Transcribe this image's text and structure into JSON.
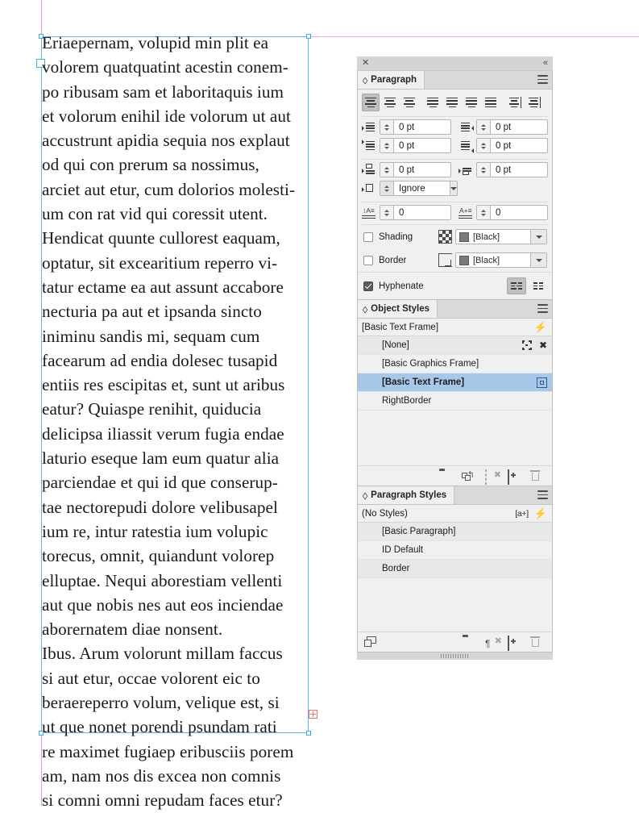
{
  "document": {
    "story_text": "Eriaepernam, volupid min plit ea\nvolorem quatquatint acestin conem-\npo ribusam sam et laboritaquis ium\net volorum enihil ide volorum ut aut\naccustrunt apidia sequia nos explaut\nod qui con prerum sa nossimus,\narciet aut etur, cum dolorios molesti-\num con rat vid qui coressit utent.\nHendicat quunte cullorest eaquam,\noptatur, sit excearitium reperro vi-\ntatur ectame ea aut assunt accabore\nnecturia pa aut et ipsanda sincto\niniminu sandis mi, sequam cum\nfacearum ad endia dolesec tusapid\nentiis res escipitas et, sunt ut aribus\neatur? Quiaspe renihit, quiducia\ndelicipsa iliassit verum fugia endae\nlaturio eseque lam eum quatur alia\nparciendae et qui id que conserup-\ntae nectorepudi dolore velibusapel\nium re, intur ratestia ium volupic\ntorecus, omnit, quiandunt volorep\nelluptae. Nequi aborestiam vellenti\naut que nobis nes aut eos inciendae\naborernatem diae nonsent.\nIbus. Arum volorunt millam faccus\nsi aut etur, occae volorent eic to\nberaereperro volum, velique est, si\nut que nonet porendi psundam rati\nre maximet fugiaep eribusciis porem\nam, nam nos dis excea non comnis\nsi comni omni repudam faces etur?",
    "guide_color": "#f49ef4",
    "frame_color": "#62b7e8"
  },
  "dock": {
    "close_label": "✕",
    "collapse_label": "«"
  },
  "paragraph_panel": {
    "tab_label": "Paragraph",
    "alignment": {
      "selected_index": 0,
      "buttons": [
        "align-left",
        "align-center",
        "align-right",
        "justify-last-left",
        "justify-last-center",
        "justify-last-right",
        "justify-all",
        "align-toward-spine",
        "align-away-from-spine"
      ]
    },
    "fields": [
      {
        "name": "left-indent",
        "value": "0 pt"
      },
      {
        "name": "right-indent",
        "value": "0 pt"
      },
      {
        "name": "first-line-indent",
        "value": "0 pt"
      },
      {
        "name": "last-line-indent",
        "value": "0 pt"
      },
      {
        "name": "space-before",
        "value": "0 pt"
      },
      {
        "name": "space-after",
        "value": "0 pt"
      },
      {
        "name": "drop-cap-lines",
        "value": "0"
      },
      {
        "name": "drop-cap-chars",
        "value": "0"
      }
    ],
    "align_to_grid": {
      "label": "Ignore"
    },
    "shading": {
      "label": "Shading",
      "checked": false,
      "color": "[Black]"
    },
    "border": {
      "label": "Border",
      "checked": false,
      "color": "[Black]"
    },
    "hyphenate": {
      "label": "Hyphenate",
      "checked": true
    }
  },
  "object_styles_panel": {
    "tab_label": "Object Styles",
    "current": "[Basic Text Frame]",
    "items": [
      {
        "label": "[None]",
        "selected": false
      },
      {
        "label": "[Basic Graphics Frame]",
        "selected": false
      },
      {
        "label": "[Basic Text Frame]",
        "selected": true
      },
      {
        "label": "RightBorder",
        "selected": false
      }
    ],
    "toolbar": [
      "new-group-folder-icon",
      "clear-overrides-icon",
      "clear-attributes-icon",
      "new-style-icon",
      "delete-style-icon"
    ]
  },
  "paragraph_styles_panel": {
    "tab_label": "Paragraph Styles",
    "current": "(No Styles)",
    "badge": "[a+]",
    "items": [
      {
        "label": "[Basic Paragraph]"
      },
      {
        "label": "ID Default"
      },
      {
        "label": "Border"
      }
    ],
    "toolbar": [
      "load-styles-icon",
      "new-group-folder-icon",
      "clear-overrides-icon",
      "new-style-icon",
      "delete-style-icon"
    ]
  }
}
